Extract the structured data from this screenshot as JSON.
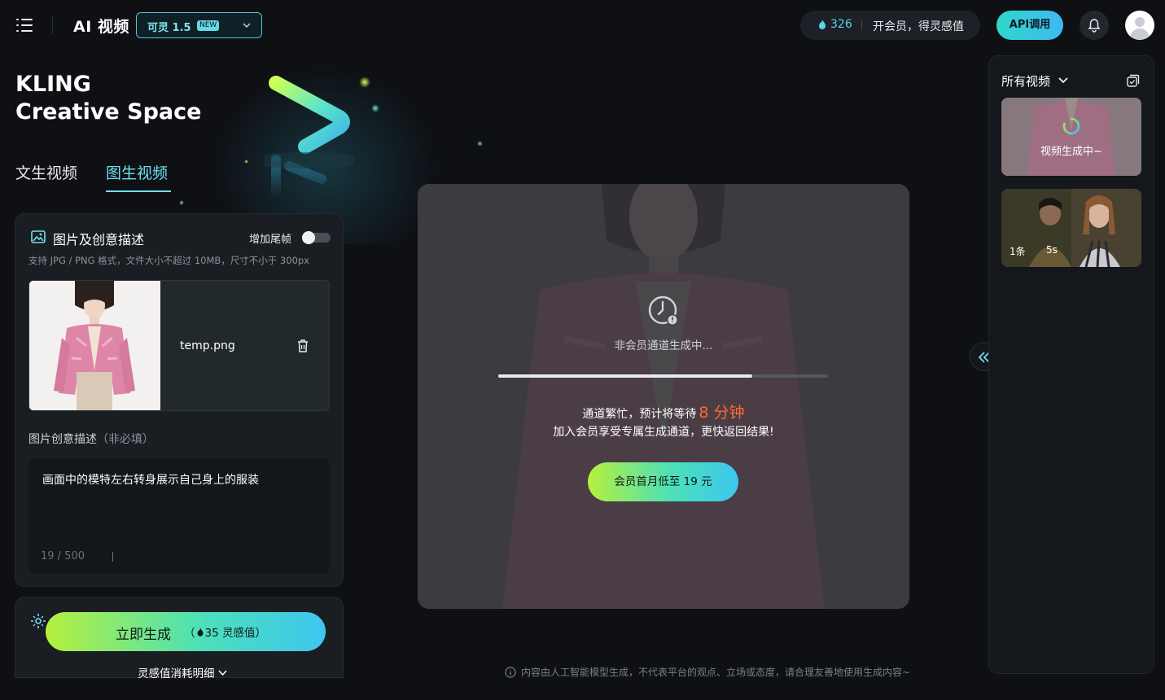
{
  "header": {
    "app_title": "AI 视频",
    "model_name": "可灵 1.5",
    "model_badge": "NEW",
    "credits": "326",
    "membership_text": "开会员，得灵感值",
    "api_label": "API调用"
  },
  "hero": {
    "line1": "KLING",
    "line2": "Creative Space"
  },
  "tabs": [
    {
      "label": "文生视频",
      "active": false
    },
    {
      "label": "图生视频",
      "active": true
    }
  ],
  "image_card": {
    "title": "图片及创意描述",
    "end_frame_label": "增加尾帧",
    "end_frame_enabled": false,
    "hint": "支持 JPG / PNG 格式，文件大小不超过 10MB，尺寸不小于 300px",
    "file_name": "temp.png",
    "prompt_label": "图片创意描述",
    "prompt_optional": "（非必填）",
    "prompt_value": "画面中的模特左右转身展示自己身上的服装",
    "prompt_count": "19 / 500"
  },
  "generate": {
    "label": "立即生成",
    "cost": "35 灵感值",
    "consume_detail": "灵感值消耗明细"
  },
  "preview": {
    "queue_status": "非会员通道生成中...",
    "progress_fraction": 0.77,
    "wait_prefix": "通道繁忙，预计将等待",
    "wait_time": "8 分钟",
    "member_line": "加入会员享受专属生成通道，更快返回结果!",
    "member_button": "会员首月低至 19 元"
  },
  "disclaimer": "内容由人工智能模型生成，不代表平台的观点、立场或态度，请合理友善地使用生成内容~",
  "right_panel": {
    "filter_label": "所有视频",
    "items": [
      {
        "status": "视频生成中~"
      },
      {
        "count": "1条",
        "duration": "5s"
      }
    ]
  },
  "colors": {
    "accent": "#6fe0ee",
    "wait_highlight": "#ff6a2c",
    "cta_gradient": [
      "#b6f03c",
      "#4de0b8",
      "#3ec6f0"
    ]
  }
}
